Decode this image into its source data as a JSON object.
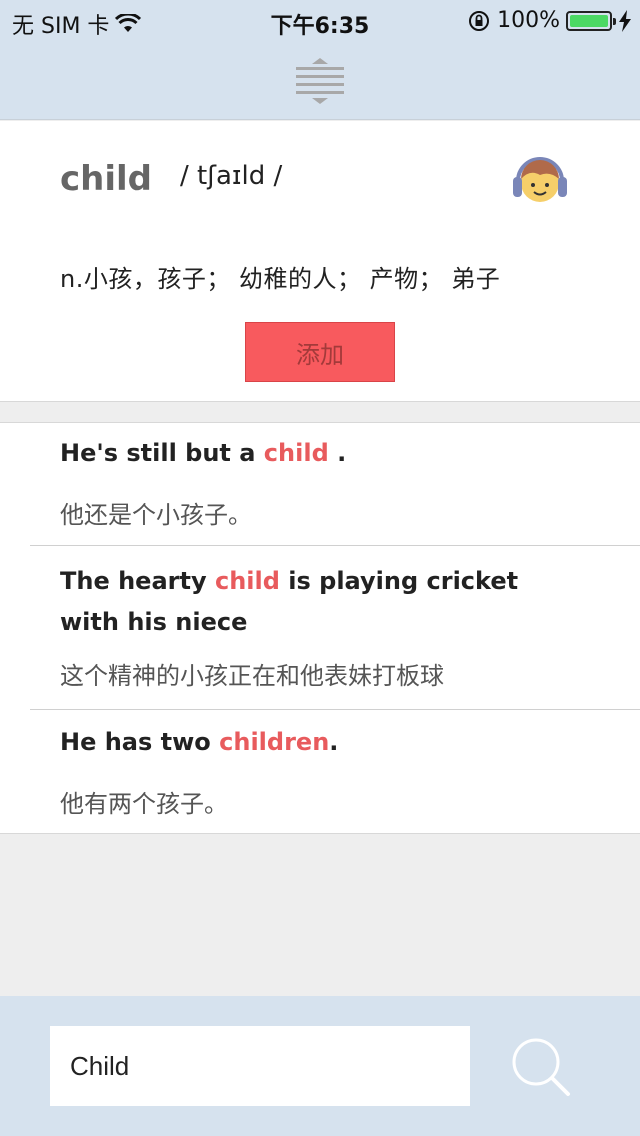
{
  "status_bar": {
    "carrier": "无 SIM 卡",
    "time": "下午6:35",
    "battery": "100%",
    "icons": [
      "wifi-icon",
      "rotation-lock-icon",
      "battery-icon",
      "charging-icon"
    ]
  },
  "word": {
    "headword": "child",
    "phonetic": "/ tʃaɪld /",
    "definition": "n.小孩，孩子； 幼稚的人； 产物； 弟子",
    "add_label": "添加",
    "audio_icon": "headphones-avatar-icon"
  },
  "examples": [
    {
      "en_before": "He's still but a ",
      "en_highlight": "child",
      "en_after": " .",
      "zh": "他还是个小孩子。"
    },
    {
      "en_before": "The hearty ",
      "en_highlight": "child",
      "en_after": " is playing cricket with his niece",
      "zh": "这个精神的小孩正在和他表妹打板球"
    },
    {
      "en_before": "He has two ",
      "en_highlight": "children",
      "en_after": ".",
      "zh": "他有两个孩子。"
    }
  ],
  "search": {
    "value": "Child",
    "icon": "search-icon"
  },
  "colors": {
    "bar_background": "#d6e2ee",
    "highlight": "#e85b5d",
    "add_button": "#f85a5e",
    "battery": "#4cd964"
  }
}
